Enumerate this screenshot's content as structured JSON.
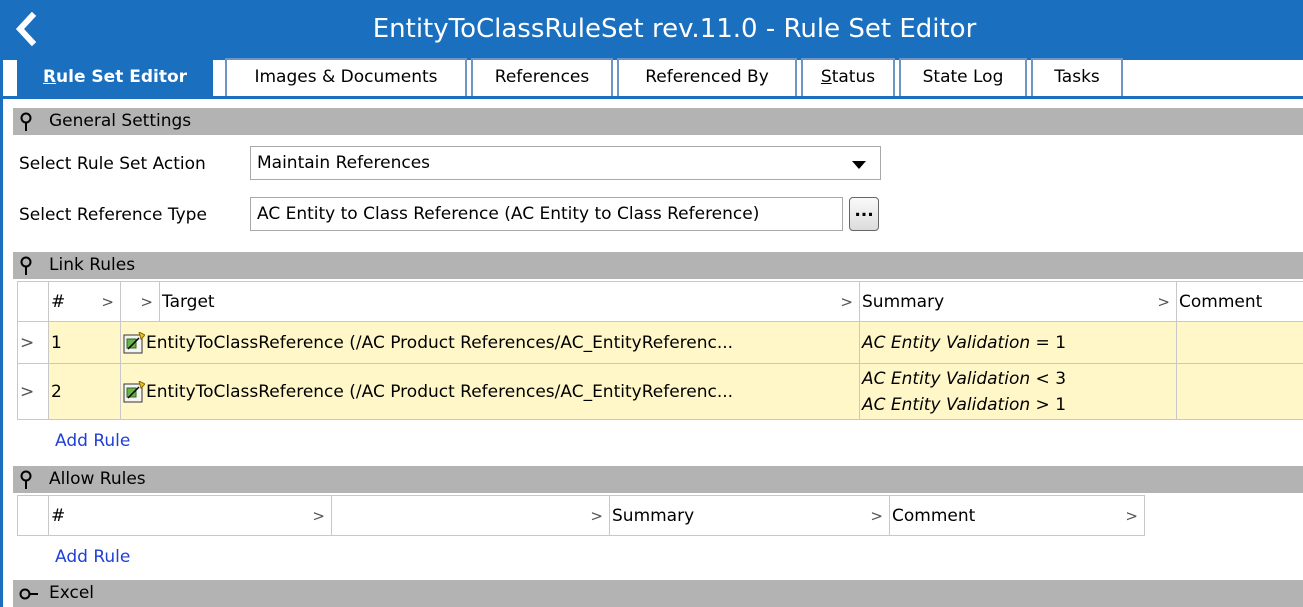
{
  "window": {
    "title": "EntityToClassRuleSet rev.11.0 - Rule Set Editor",
    "back_icon": "chevron-left-icon",
    "accent_color": "#1a6fbf"
  },
  "tabs": [
    {
      "label": "Rule Set Editor",
      "active": true,
      "mnemonic": "R"
    },
    {
      "label": "Images & Documents"
    },
    {
      "label": "References"
    },
    {
      "label": "Referenced By"
    },
    {
      "label": "Status",
      "mnemonic": "S"
    },
    {
      "label": "State Log"
    },
    {
      "label": "Tasks"
    }
  ],
  "general_settings": {
    "header": "General Settings",
    "action_label": "Select Rule Set Action",
    "action_value": "Maintain References",
    "reference_label": "Select Reference Type",
    "reference_value": "AC Entity to Class Reference (AC Entity to Class Reference)",
    "browse_label": "..."
  },
  "link_rules": {
    "header": "Link Rules",
    "columns": [
      "#",
      "Target",
      "Summary",
      "Comment"
    ],
    "rows": [
      {
        "num": "1",
        "target": "EntityToClassReference (/AC Product References/AC_EntityReferenc...",
        "summary": [
          {
            "attr": "AC Entity Validation",
            "op": "=",
            "val": "1"
          }
        ],
        "comment": ""
      },
      {
        "num": "2",
        "target": "EntityToClassReference (/AC Product References/AC_EntityReferenc...",
        "summary": [
          {
            "attr": "AC Entity Validation",
            "op": "<",
            "val": "3"
          },
          {
            "attr": "AC Entity Validation",
            "op": ">",
            "val": "1"
          }
        ],
        "comment": ""
      }
    ],
    "row_fill_color": "#fff7c8",
    "add_label": "Add Rule"
  },
  "allow_rules": {
    "header": "Allow Rules",
    "columns": [
      "#",
      "",
      "Summary",
      "Comment"
    ],
    "add_label": "Add Rule"
  },
  "excel": {
    "header": "Excel"
  }
}
